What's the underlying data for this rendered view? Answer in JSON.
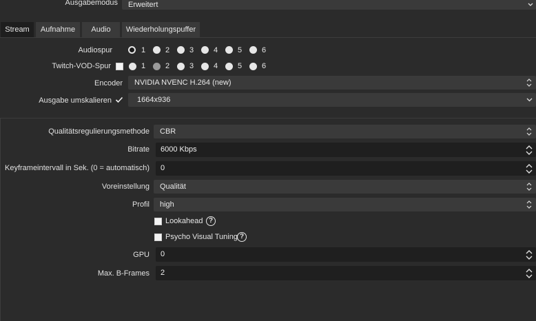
{
  "output_mode": {
    "label": "Ausgabemodus",
    "value": "Erweitert"
  },
  "tabs": [
    {
      "label": "Stream",
      "active": true
    },
    {
      "label": "Aufnahme",
      "active": false
    },
    {
      "label": "Audio",
      "active": false
    },
    {
      "label": "Wiederholungspuffer",
      "active": false
    }
  ],
  "stream": {
    "audio_track": {
      "label": "Audiospur",
      "options": [
        "1",
        "2",
        "3",
        "4",
        "5",
        "6"
      ],
      "selected": "1"
    },
    "vod_track": {
      "label": "Twitch-VOD-Spur",
      "checked": false,
      "options": [
        "1",
        "2",
        "3",
        "4",
        "5",
        "6"
      ],
      "selected": "2"
    },
    "encoder": {
      "label": "Encoder",
      "value": "NVIDIA NVENC H.264 (new)"
    },
    "rescale": {
      "label": "Ausgabe umskalieren",
      "checked": true,
      "value": "1664x936"
    }
  },
  "encoder_settings": {
    "rate_control": {
      "label": "Qualitätsregulierungsmethode",
      "value": "CBR"
    },
    "bitrate": {
      "label": "Bitrate",
      "value": "6000 Kbps"
    },
    "keyframe": {
      "label": "Keyframeintervall in Sek. (0 = automatisch)",
      "value": "0"
    },
    "preset": {
      "label": "Voreinstellung",
      "value": "Qualität"
    },
    "profile": {
      "label": "Profil",
      "value": "high"
    },
    "lookahead": {
      "label": "Lookahead",
      "checked": false
    },
    "psycho_visual": {
      "label": "Psycho Visual Tuning",
      "checked": false
    },
    "gpu": {
      "label": "GPU",
      "value": "0"
    },
    "bframes": {
      "label": "Max. B-Frames",
      "value": "2"
    }
  },
  "icons": {
    "help": "?"
  },
  "colors": {
    "background": "#2b2b2b",
    "field": "#3a3a3a",
    "spinbox": "#1f1f1f",
    "text": "#e0e0e0"
  }
}
